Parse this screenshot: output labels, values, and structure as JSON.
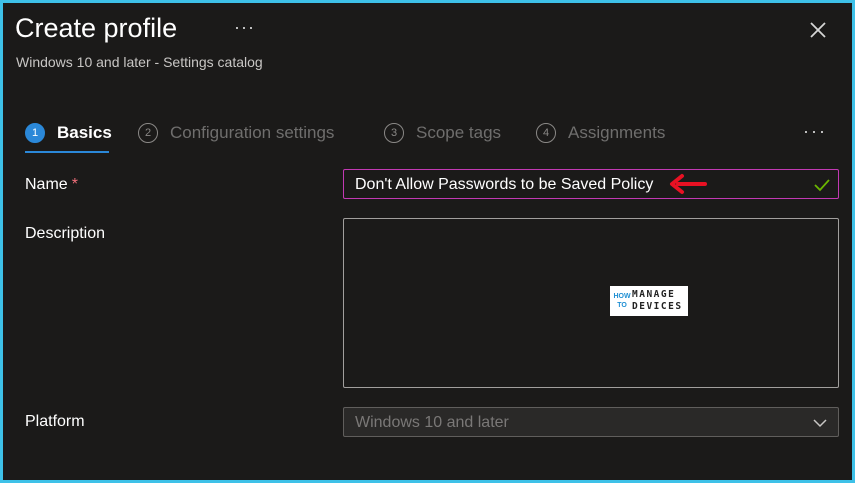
{
  "header": {
    "title": "Create profile",
    "more_label": "···",
    "subtitle": "Windows 10 and later - Settings catalog"
  },
  "tabs": [
    {
      "num": "1",
      "label": "Basics",
      "active": true
    },
    {
      "num": "2",
      "label": "Configuration settings",
      "active": false
    },
    {
      "num": "3",
      "label": "Scope tags",
      "active": false
    },
    {
      "num": "4",
      "label": "Assignments",
      "active": false
    }
  ],
  "tabs_more": "···",
  "form": {
    "name_label": "Name",
    "name_required": "*",
    "name_value": "Don't Allow Passwords to be Saved Policy",
    "description_label": "Description",
    "description_value": "",
    "platform_label": "Platform",
    "platform_value": "Windows 10 and later"
  },
  "watermark": {
    "how_to": "HOW TO",
    "line1": "MANAGE",
    "line2": "DEVICES"
  },
  "colors": {
    "accent": "#2b88d8",
    "focus_border": "#c239b3",
    "annotation_arrow": "#e81123",
    "valid_check": "#6bb700",
    "frame_border": "#3ec1e8"
  },
  "icons": {
    "close": "close-icon",
    "check": "checkmark-icon",
    "chevron": "chevron-down-icon",
    "arrow": "arrow-left-icon"
  }
}
